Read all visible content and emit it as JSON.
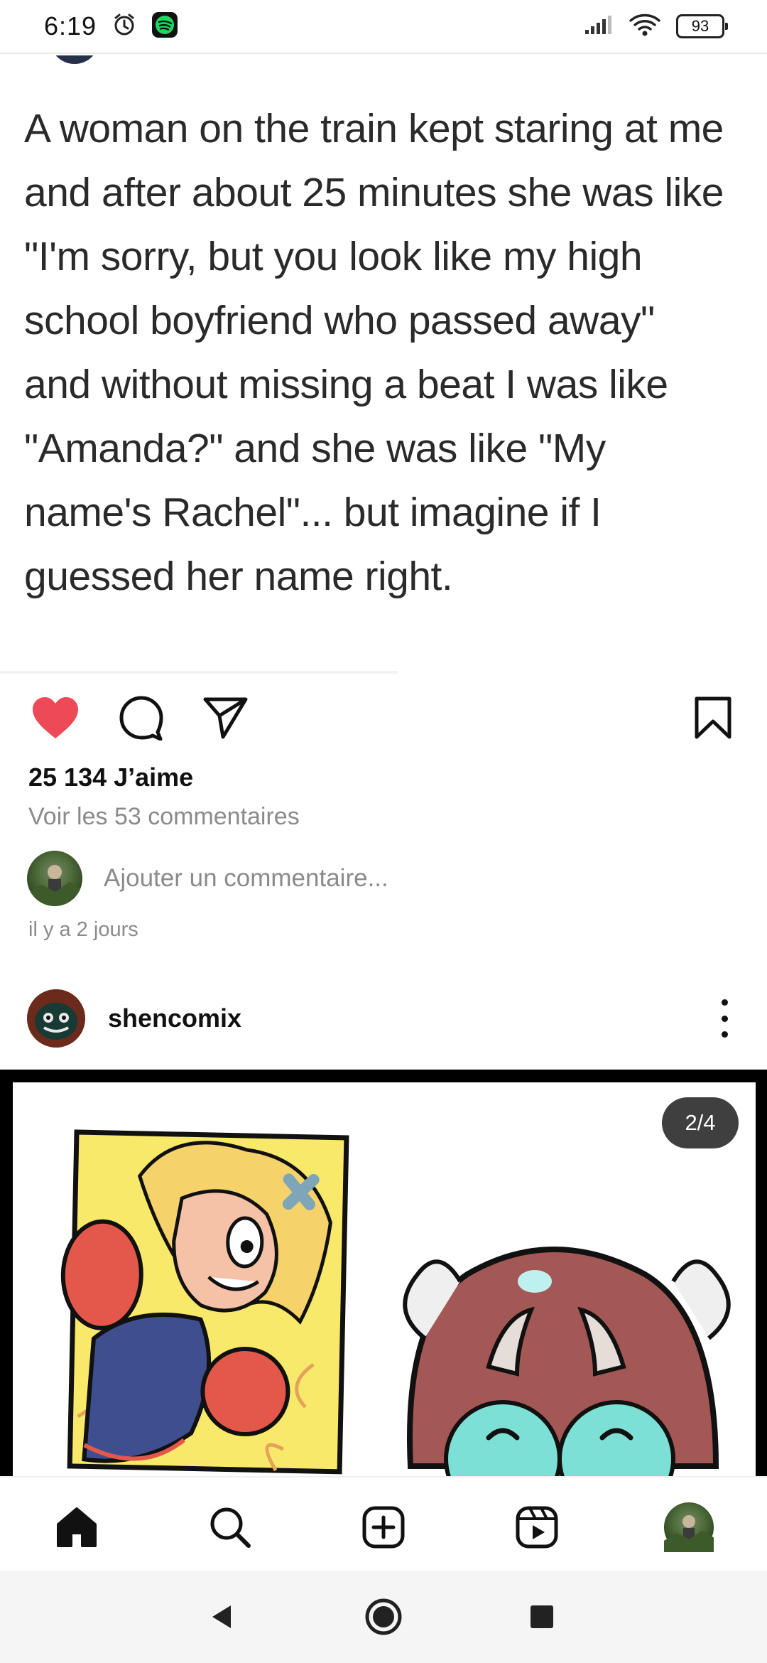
{
  "status_bar": {
    "time": "6:19",
    "battery": "93",
    "icons": [
      "alarm-icon",
      "spotify-icon",
      "signal-icon",
      "wifi-icon",
      "battery-icon"
    ]
  },
  "quote_post": {
    "text": "A woman on the train kept staring at me\nand after about 25 minutes she was like\n\"I'm sorry, but you look like my high\nschool boyfriend who passed away\"\nand without missing a beat I was like\n\"Amanda?\" and she was like \"My\nname's Rachel\"... but imagine if I\nguessed her name right."
  },
  "actions": {
    "liked": true,
    "like_color": "#ed4956",
    "likes": "25 134 J’aime",
    "view_comments": "Voir les 53 commentaires",
    "add_comment_placeholder": "Ajouter un commentaire...",
    "posted_time": "il y a 2 jours"
  },
  "next_post": {
    "username": "shencomix",
    "page_indicator": "2/4"
  },
  "bottom_nav": [
    "home-icon",
    "search-icon",
    "create-icon",
    "reels-icon",
    "profile-avatar"
  ],
  "system_nav": [
    "back-icon",
    "home-circle-icon",
    "recents-icon"
  ]
}
